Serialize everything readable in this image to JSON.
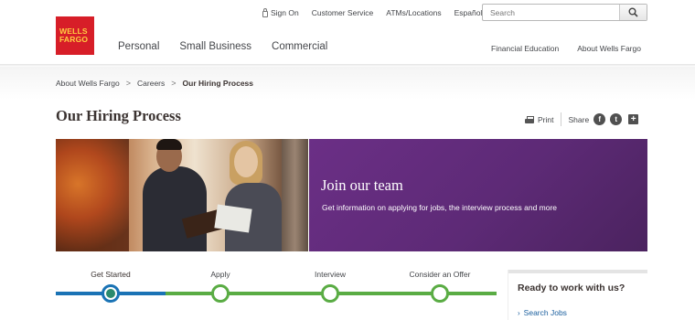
{
  "logo": {
    "line1": "WELLS",
    "line2": "FARGO",
    "colors": {
      "bg": "#d71e28",
      "text": "#ffcd41"
    }
  },
  "utility": {
    "sign_on": "Sign On",
    "customer_service": "Customer Service",
    "atms": "ATMs/Locations",
    "espanol": "Español"
  },
  "search": {
    "placeholder": "Search",
    "icon": "search-icon"
  },
  "mainnav": {
    "personal": "Personal",
    "small_business": "Small Business",
    "commercial": "Commercial"
  },
  "secnav": {
    "financial_education": "Financial Education",
    "about": "About Wells Fargo"
  },
  "breadcrumb": {
    "items": [
      "About Wells Fargo",
      "Careers"
    ],
    "current": "Our Hiring Process",
    "separator": ">"
  },
  "page": {
    "title": "Our Hiring Process"
  },
  "tools": {
    "print": "Print",
    "share": "Share",
    "icons": [
      "facebook-icon",
      "twitter-icon",
      "plus-icon"
    ]
  },
  "hero": {
    "heading": "Join our team",
    "text": "Get information on applying for jobs, the interview process and more",
    "panel_color": "#5d2a76"
  },
  "steps": {
    "items": [
      "Get Started",
      "Apply",
      "Interview",
      "Consider an Offer"
    ],
    "active_index": 0,
    "colors": {
      "active": "#1a73b5",
      "inactive": "#5aac44"
    }
  },
  "ready": {
    "heading": "Ready to work with us?",
    "link": "Search Jobs"
  }
}
